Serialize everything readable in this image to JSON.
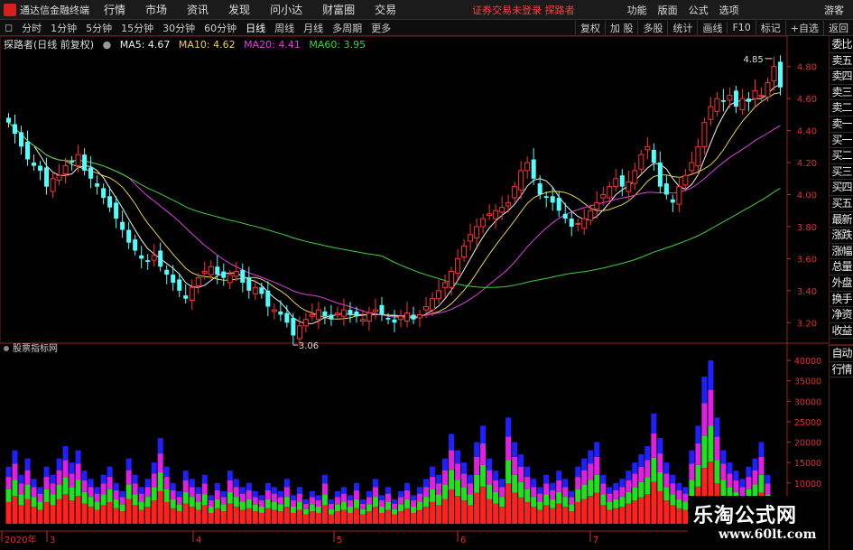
{
  "app": {
    "title": "通达信金融终端"
  },
  "menu": [
    "行情",
    "市场",
    "资讯",
    "发现",
    "问小达",
    "财富圈",
    "交易"
  ],
  "warning": "证券交易未登录  探路者",
  "right_menu": [
    "功能",
    "版面",
    "公式",
    "选项"
  ],
  "guest": "游客",
  "periods": [
    "分时",
    "1分钟",
    "5分钟",
    "15分钟",
    "30分钟",
    "60分钟",
    "日线",
    "周线",
    "月线",
    "多周期",
    "更多"
  ],
  "period_active": "日线",
  "toolbar_right": [
    "复权",
    "加 股",
    "多股",
    "统计",
    "画线",
    "F10",
    "标记",
    "+自选",
    "返回"
  ],
  "legend": {
    "name": "探路者(日线 前复权)",
    "ma5": "MA5: 4.67",
    "ma10": "MA10: 4.62",
    "ma20": "MA20: 4.41",
    "ma60": "MA60: 3.95"
  },
  "side_buttons": [
    "委比",
    "卖五",
    "卖四",
    "卖三",
    "卖二",
    "卖一",
    "买一",
    "买二",
    "买三",
    "买四",
    "买五",
    "最新",
    "涨跌",
    "涨幅",
    "总量",
    "外盘",
    "换手",
    "净资",
    "收益"
  ],
  "side_buttons2": [
    "自动",
    "行情"
  ],
  "indicator_label": "股票指标网",
  "watermark": {
    "line1": "乐淘公式网",
    "line2": "www.60lt.com"
  },
  "chart_data": {
    "type": "candlestick",
    "price_axis": {
      "labels": [
        "4.80",
        "4.60",
        "4.40",
        "4.20",
        "4.00",
        "3.80",
        "3.60",
        "3.40",
        "3.20"
      ],
      "range": [
        3.1,
        4.9
      ]
    },
    "annotations": {
      "high": "4.85",
      "low": "3.06"
    },
    "volume_axis": {
      "labels": [
        "40000",
        "35000",
        "30000",
        "25000",
        "20000",
        "15000",
        "10000"
      ],
      "range": [
        0,
        42000
      ]
    },
    "date_axis": [
      "2020年",
      "3",
      "4",
      "5",
      "6",
      "7"
    ],
    "closes": [
      4.45,
      4.38,
      4.3,
      4.22,
      4.18,
      4.15,
      4.05,
      4.1,
      4.12,
      4.18,
      4.2,
      4.25,
      4.15,
      4.1,
      4.05,
      3.98,
      3.92,
      3.85,
      3.78,
      3.7,
      3.65,
      3.6,
      3.58,
      3.62,
      3.55,
      3.5,
      3.45,
      3.4,
      3.35,
      3.42,
      3.48,
      3.52,
      3.55,
      3.5,
      3.48,
      3.5,
      3.52,
      3.45,
      3.4,
      3.42,
      3.38,
      3.3,
      3.28,
      3.25,
      3.2,
      3.12,
      3.18,
      3.22,
      3.25,
      3.28,
      3.24,
      3.22,
      3.26,
      3.28,
      3.25,
      3.24,
      3.22,
      3.26,
      3.28,
      3.25,
      3.22,
      3.2,
      3.24,
      3.26,
      3.22,
      3.25,
      3.3,
      3.35,
      3.4,
      3.45,
      3.52,
      3.6,
      3.68,
      3.75,
      3.8,
      3.85,
      3.88,
      3.9,
      3.92,
      3.95,
      4.05,
      4.15,
      4.2,
      4.1,
      4.0,
      3.98,
      3.95,
      3.9,
      3.85,
      3.8,
      3.82,
      3.85,
      3.9,
      3.95,
      4.0,
      4.05,
      4.1,
      4.05,
      4.08,
      4.15,
      4.25,
      4.3,
      4.2,
      4.05,
      4.0,
      3.95,
      4.05,
      4.12,
      4.2,
      4.3,
      4.45,
      4.55,
      4.6,
      4.58,
      4.62,
      4.55,
      4.6,
      4.58,
      4.65,
      4.62,
      4.7,
      4.8,
      4.67
    ],
    "volumes": [
      14000,
      18000,
      12000,
      16000,
      11000,
      9000,
      14000,
      12000,
      16000,
      19000,
      15000,
      18000,
      13000,
      11000,
      9000,
      12000,
      14000,
      10000,
      8000,
      16000,
      12000,
      9000,
      11000,
      15000,
      21000,
      14000,
      10000,
      8000,
      13000,
      11000,
      9000,
      12000,
      7000,
      10000,
      8000,
      13000,
      11000,
      9000,
      10000,
      8000,
      7000,
      10000,
      9000,
      8000,
      11000,
      7000,
      9000,
      6000,
      8000,
      7000,
      12000,
      6000,
      8000,
      9000,
      7000,
      10000,
      6000,
      8000,
      11000,
      7000,
      9000,
      6000,
      8000,
      10000,
      7000,
      9000,
      11000,
      14000,
      12000,
      16000,
      22000,
      18000,
      15000,
      12000,
      20000,
      24000,
      16000,
      13000,
      11000,
      26000,
      20000,
      17000,
      14000,
      11000,
      9000,
      12000,
      10000,
      13000,
      11000,
      8000,
      14000,
      16000,
      18000,
      20000,
      12000,
      9000,
      10000,
      11000,
      13000,
      15000,
      17000,
      19000,
      27000,
      21000,
      15000,
      12000,
      10000,
      9000,
      18000,
      24000,
      36000,
      40000,
      26000,
      18000,
      15000,
      13000,
      11000,
      14000,
      16000,
      20000,
      12000
    ]
  }
}
